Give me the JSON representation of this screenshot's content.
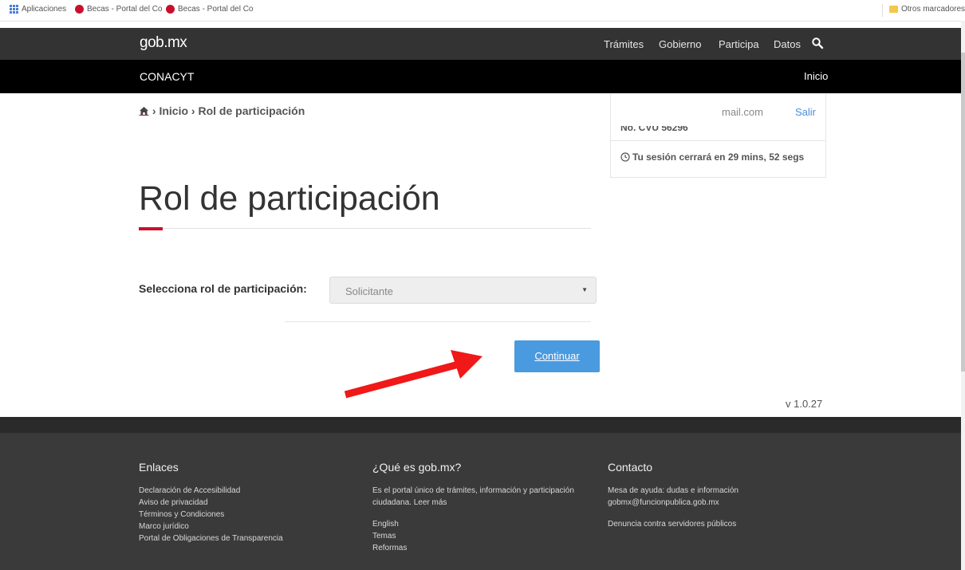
{
  "bookmarks": {
    "apps": "Aplicaciones",
    "items": [
      "Becas - Portal del Co",
      "Becas - Portal del Co"
    ],
    "other": "Otros marcadores"
  },
  "header": {
    "brand": "gob.mx",
    "nav": [
      "Trámites",
      "Gobierno",
      "Participa",
      "Datos"
    ],
    "subbrand": "CONACYT",
    "home_link": "Inicio"
  },
  "breadcrumb": {
    "home_label": "Inicio",
    "current": "Rol de participación",
    "separator": "›"
  },
  "session": {
    "email": "mail.com",
    "logout": "Salir",
    "cvu": "No. CVU 56296",
    "timer": "Tu sesión cerrará en 29 mins, 52 segs"
  },
  "main": {
    "title": "Rol de participación",
    "form_label": "Selecciona rol de participación:",
    "select_value": "Solicitante",
    "continue": "Continuar",
    "version": "v 1.0.27"
  },
  "footer": {
    "links_title": "Enlaces",
    "links": [
      "Declaración de Accesibilidad",
      "Aviso de privacidad",
      "Términos y Condiciones",
      "Marco jurídico",
      "Portal de Obligaciones de Transparencia"
    ],
    "about_title": "¿Qué es gob.mx?",
    "about_text": "Es el portal único de trámites, información y participación ciudadana. Leer más",
    "about_links": [
      "English",
      "Temas",
      "Reformas"
    ],
    "contact_title": "Contacto",
    "contact_text": "Mesa de ayuda: dudas e información gobmx@funcionpublica.gob.mx",
    "contact_link": "Denuncia contra servidores públicos"
  },
  "colors": {
    "header": "#333333",
    "subheader": "#000000",
    "accent": "#c8102e",
    "button": "#4a9ae0",
    "footer": "#3a3a3a"
  }
}
